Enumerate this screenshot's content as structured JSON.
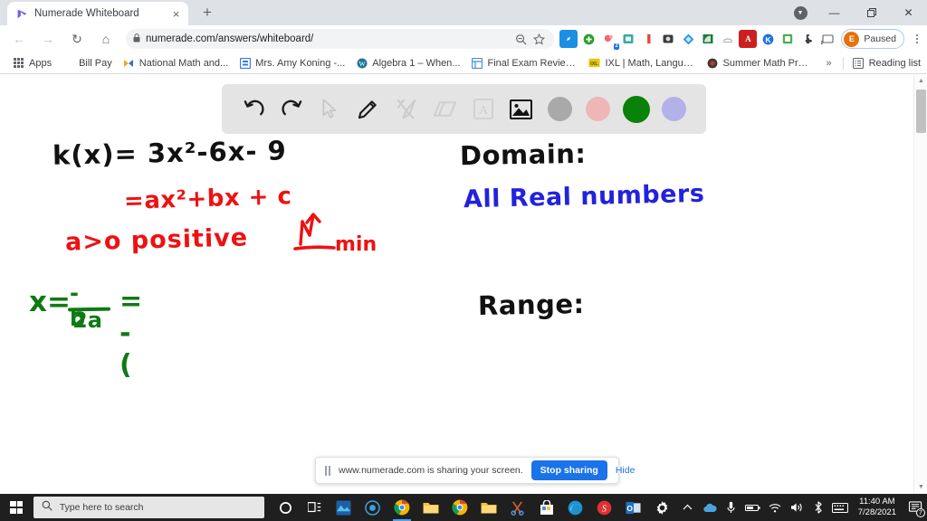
{
  "browser": {
    "tab": {
      "title": "Numerade Whiteboard",
      "favicon": "numerade-logo-icon",
      "close_label": "×"
    },
    "new_tab_label": "+",
    "window_controls": {
      "extra": "▼",
      "minimize": "—",
      "maximize": "❐",
      "close": "✕"
    },
    "nav": {
      "back": "←",
      "forward": "→",
      "reload": "↻",
      "home": "⌂"
    },
    "omnibox": {
      "lock": "🔒",
      "url": "numerade.com/answers/whiteboard/",
      "zoom_out_icon": "search-minus-icon",
      "bookmark_icon": "star-icon"
    },
    "extensions": [
      {
        "name": "compass-extension",
        "glyph": "◉",
        "color": "#1a8fe3",
        "badge": ""
      },
      {
        "name": "green-plus-extension",
        "glyph": "✚",
        "color": "#2aa02a",
        "badge": ""
      },
      {
        "name": "bitmoji-extension",
        "glyph": "◕",
        "color": "#f06a6a",
        "badge": "2"
      },
      {
        "name": "screencast-extension",
        "glyph": "▣",
        "color": "#3ba7a7",
        "badge": ""
      },
      {
        "name": "book-extension",
        "glyph": "▐",
        "color": "#e8453c",
        "badge": ""
      },
      {
        "name": "camera-extension",
        "glyph": "●",
        "color": "#3c3c3c",
        "badge": ""
      },
      {
        "name": "diamond-extension",
        "glyph": "◆",
        "color": "#2196f3",
        "badge": ""
      },
      {
        "name": "rss-extension",
        "glyph": "◢",
        "color": "#1f7a3f",
        "badge": ""
      },
      {
        "name": "gray-extension",
        "glyph": "≈",
        "color": "#c8c8c8",
        "badge": ""
      },
      {
        "name": "adobe-acrobat-extension",
        "glyph": "A",
        "color": "#cc1f1f",
        "badge": ""
      },
      {
        "name": "kami-extension",
        "glyph": "K",
        "color": "#1a73e8",
        "badge": ""
      },
      {
        "name": "notes-extension",
        "glyph": "■",
        "color": "#4caf50",
        "badge": ""
      },
      {
        "name": "puzzle-extensions-icon",
        "glyph": "✸",
        "color": "#5f6368",
        "badge": ""
      },
      {
        "name": "cast-icon",
        "glyph": "⬚",
        "color": "#5f6368",
        "badge": ""
      }
    ],
    "profile": {
      "initial": "E",
      "label": "Paused"
    },
    "menu_icon": "kebab-menu-icon"
  },
  "bookmarks": {
    "apps_label": "Apps",
    "items": [
      {
        "label": "Bill Pay",
        "icon_color": "",
        "glyph": ""
      },
      {
        "label": "National Math and...",
        "icon_color": "#f5a623",
        "glyph": "✖"
      },
      {
        "label": "Mrs. Amy Koning -...",
        "icon_color": "#3b78e7",
        "glyph": "⊞"
      },
      {
        "label": "Algebra 1 – When...",
        "icon_color": "#21759b",
        "glyph": "W"
      },
      {
        "label": "Final Exam Review -...",
        "icon_color": "#4a90e2",
        "glyph": "⊞"
      },
      {
        "label": "IXL | Math, Languag...",
        "icon_color": "#f2c200",
        "glyph": "IXL"
      },
      {
        "label": "Summer Math Pract...",
        "icon_color": "#b03030",
        "glyph": "●"
      }
    ],
    "overflow_label": "»",
    "reading_list_label": "Reading list"
  },
  "whiteboard": {
    "toolbar": [
      {
        "name": "undo-icon",
        "type": "icon",
        "label": "undo",
        "enabled": true
      },
      {
        "name": "redo-icon",
        "type": "icon",
        "label": "redo",
        "enabled": true
      },
      {
        "name": "cursor-select-icon",
        "type": "icon",
        "label": "select",
        "enabled": false
      },
      {
        "name": "pencil-icon",
        "type": "icon",
        "label": "pencil",
        "enabled": true
      },
      {
        "name": "shapes-tools-icon",
        "type": "icon",
        "label": "tools",
        "enabled": false
      },
      {
        "name": "eraser-icon",
        "type": "icon",
        "label": "eraser",
        "enabled": false
      },
      {
        "name": "text-box-icon",
        "type": "icon",
        "label": "text",
        "enabled": false
      },
      {
        "name": "image-icon",
        "type": "icon",
        "label": "insert image",
        "enabled": true
      },
      {
        "name": "color-swatch-gray",
        "type": "swatch",
        "color": "#a9a9a9",
        "selected": false
      },
      {
        "name": "color-swatch-pink",
        "type": "swatch",
        "color": "#efb6b6",
        "selected": false
      },
      {
        "name": "color-swatch-green",
        "type": "swatch",
        "color": "#098209",
        "selected": true
      },
      {
        "name": "color-swatch-periwinkle",
        "type": "swatch",
        "color": "#b2b2e8",
        "selected": false
      }
    ],
    "ink": {
      "black_color": "#111111",
      "red_color": "#ee1111",
      "blue_color": "#2222dd",
      "green_color": "#0f7a14",
      "line_1": "k(x)= 3x²-6x- 9",
      "line_2": "=ax²+bx + c",
      "line_3": "a>o positive",
      "line_4_annotation": "min",
      "line_5_x": "x=",
      "line_5_num": "-b",
      "line_5_den": "2a",
      "line_5_result": "= -(",
      "domain_label": "Domain:",
      "domain_value": "All  Real  numbers",
      "range_label": "Range:"
    }
  },
  "share_bar": {
    "pause_icon": "pause-icon",
    "message": "www.numerade.com is sharing your screen.",
    "stop_label": "Stop sharing",
    "hide_label": "Hide"
  },
  "scrollbar": {
    "up": "▲",
    "down": "▼"
  },
  "taskbar": {
    "start_label": "start-button",
    "search_placeholder": "Type here to search",
    "search_icon": "magnifier-icon",
    "icons": [
      {
        "name": "cortana-icon",
        "glyph": "○",
        "color": "#ffffff",
        "active": false
      },
      {
        "name": "task-view-icon",
        "glyph": "⌸",
        "color": "#ffffff",
        "active": false
      },
      {
        "name": "photos-app-icon",
        "glyph": "〜",
        "color": "#2f9bd6",
        "active": false
      },
      {
        "name": "media-app-icon",
        "glyph": "◉",
        "color": "#3d9fe0",
        "active": false
      },
      {
        "name": "chrome-icon",
        "glyph": "◔",
        "color": "#e8453c",
        "active": true
      },
      {
        "name": "file-explorer-icon",
        "glyph": "🗀",
        "color": "#f0b429",
        "active": false
      },
      {
        "name": "chrome-2-icon",
        "glyph": "◔",
        "color": "#e8453c",
        "active": false
      },
      {
        "name": "folder-icon",
        "glyph": "🗀",
        "color": "#f0b429",
        "active": false
      },
      {
        "name": "snip-sketch-icon",
        "glyph": "✂",
        "color": "#d45a2a",
        "active": false
      },
      {
        "name": "microsoft-store-icon",
        "glyph": "⊞",
        "color": "#ffffff",
        "active": false
      },
      {
        "name": "edge-icon",
        "glyph": "◕",
        "color": "#2a8ad4",
        "active": false
      },
      {
        "name": "smart-notebook-icon",
        "glyph": "S",
        "color": "#e03030",
        "active": false
      },
      {
        "name": "outlook-icon",
        "glyph": "O",
        "color": "#1f6fc4",
        "active": false
      },
      {
        "name": "settings-gear-icon",
        "glyph": "⚙",
        "color": "#ffffff",
        "active": false
      }
    ],
    "tray": [
      {
        "name": "show-hidden-icons",
        "glyph": "⌃"
      },
      {
        "name": "onedrive-icon",
        "glyph": "☁"
      },
      {
        "name": "microphone-icon",
        "glyph": "⬤"
      },
      {
        "name": "battery-icon",
        "glyph": "▬"
      },
      {
        "name": "wifi-icon",
        "glyph": "◠"
      },
      {
        "name": "volume-icon",
        "glyph": "🔊"
      },
      {
        "name": "bluetooth-icon",
        "glyph": "ᛦ"
      },
      {
        "name": "keyboard-icon",
        "glyph": "⌨"
      }
    ],
    "clock": {
      "time": "11:40 AM",
      "date": "7/28/2021"
    },
    "notifications": {
      "icon": "notification-icon",
      "count": "7"
    }
  }
}
